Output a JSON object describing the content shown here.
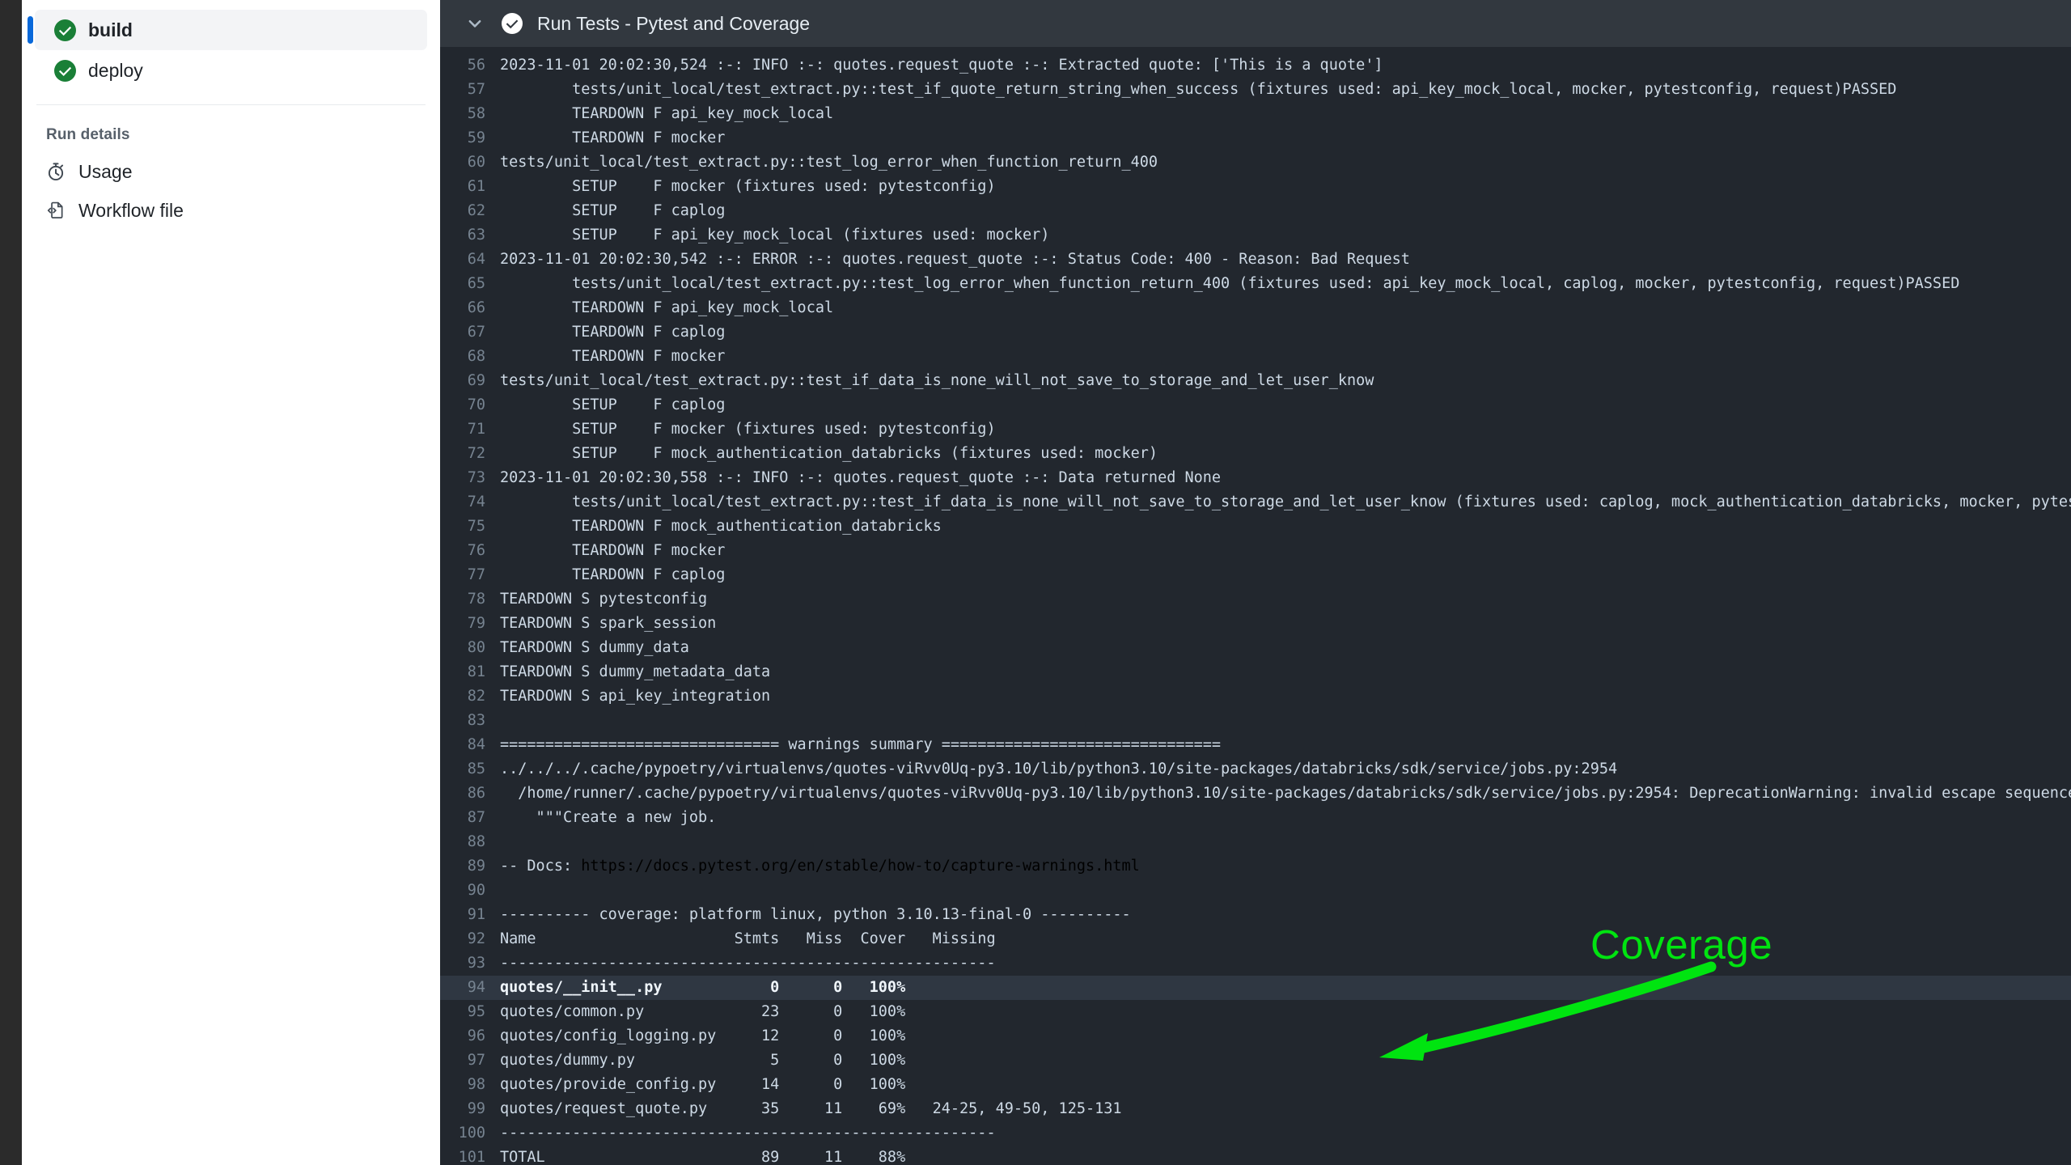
{
  "sidebar": {
    "jobs": [
      {
        "label": "build",
        "icon": "check-circle-success-icon",
        "active": true
      },
      {
        "label": "deploy",
        "icon": "check-circle-success-icon",
        "active": false
      }
    ],
    "section_title": "Run details",
    "details": [
      {
        "label": "Usage",
        "icon": "stopwatch-icon"
      },
      {
        "label": "Workflow file",
        "icon": "code-file-icon"
      }
    ]
  },
  "log": {
    "header": {
      "title": "Run Tests - Pytest and Coverage",
      "chevron_icon": "chevron-down-icon",
      "status_icon": "check-circle-icon"
    },
    "lines": [
      {
        "n": "56",
        "text": "2023-11-01 20:02:30,524 :-: INFO :-: quotes.request_quote :-: Extracted quote: ['This is a quote']"
      },
      {
        "n": "57",
        "text": "        tests/unit_local/test_extract.py::test_if_quote_return_string_when_success (fixtures used: api_key_mock_local, mocker, pytestconfig, request)PASSED"
      },
      {
        "n": "58",
        "text": "        TEARDOWN F api_key_mock_local"
      },
      {
        "n": "59",
        "text": "        TEARDOWN F mocker"
      },
      {
        "n": "60",
        "text": "tests/unit_local/test_extract.py::test_log_error_when_function_return_400"
      },
      {
        "n": "61",
        "text": "        SETUP    F mocker (fixtures used: pytestconfig)"
      },
      {
        "n": "62",
        "text": "        SETUP    F caplog"
      },
      {
        "n": "63",
        "text": "        SETUP    F api_key_mock_local (fixtures used: mocker)"
      },
      {
        "n": "64",
        "text": "2023-11-01 20:02:30,542 :-: ERROR :-: quotes.request_quote :-: Status Code: 400 - Reason: Bad Request"
      },
      {
        "n": "65",
        "text": "        tests/unit_local/test_extract.py::test_log_error_when_function_return_400 (fixtures used: api_key_mock_local, caplog, mocker, pytestconfig, request)PASSED"
      },
      {
        "n": "66",
        "text": "        TEARDOWN F api_key_mock_local"
      },
      {
        "n": "67",
        "text": "        TEARDOWN F caplog"
      },
      {
        "n": "68",
        "text": "        TEARDOWN F mocker"
      },
      {
        "n": "69",
        "text": "tests/unit_local/test_extract.py::test_if_data_is_none_will_not_save_to_storage_and_let_user_know"
      },
      {
        "n": "70",
        "text": "        SETUP    F caplog"
      },
      {
        "n": "71",
        "text": "        SETUP    F mocker (fixtures used: pytestconfig)"
      },
      {
        "n": "72",
        "text": "        SETUP    F mock_authentication_databricks (fixtures used: mocker)"
      },
      {
        "n": "73",
        "text": "2023-11-01 20:02:30,558 :-: INFO :-: quotes.request_quote :-: Data returned None"
      },
      {
        "n": "74",
        "text": "        tests/unit_local/test_extract.py::test_if_data_is_none_will_not_save_to_storage_and_let_user_know (fixtures used: caplog, mock_authentication_databricks, mocker, pytestconfig, request)PASSED"
      },
      {
        "n": "75",
        "text": "        TEARDOWN F mock_authentication_databricks"
      },
      {
        "n": "76",
        "text": "        TEARDOWN F mocker"
      },
      {
        "n": "77",
        "text": "        TEARDOWN F caplog"
      },
      {
        "n": "78",
        "text": "TEARDOWN S pytestconfig"
      },
      {
        "n": "79",
        "text": "TEARDOWN S spark_session"
      },
      {
        "n": "80",
        "text": "TEARDOWN S dummy_data"
      },
      {
        "n": "81",
        "text": "TEARDOWN S dummy_metadata_data"
      },
      {
        "n": "82",
        "text": "TEARDOWN S api_key_integration"
      },
      {
        "n": "83",
        "text": ""
      },
      {
        "n": "84",
        "text": "=============================== warnings summary ==============================="
      },
      {
        "n": "85",
        "text": "../../../.cache/pypoetry/virtualenvs/quotes-viRvv0Uq-py3.10/lib/python3.10/site-packages/databricks/sdk/service/jobs.py:2954"
      },
      {
        "n": "86",
        "text": "  /home/runner/.cache/pypoetry/virtualenvs/quotes-viRvv0Uq-py3.10/lib/python3.10/site-packages/databricks/sdk/service/jobs.py:2954: DeprecationWarning: invalid escape sequence '\\.'"
      },
      {
        "n": "87",
        "text": "    \"\"\"Create a new job."
      },
      {
        "n": "88",
        "text": ""
      },
      {
        "n": "89",
        "text": "-- Docs: ",
        "link": "https://docs.pytest.org/en/stable/how-to/capture-warnings.html"
      },
      {
        "n": "90",
        "text": ""
      },
      {
        "n": "91",
        "text": "---------- coverage: platform linux, python 3.10.13-final-0 ----------"
      },
      {
        "n": "92",
        "text": "Name                      Stmts   Miss  Cover   Missing"
      },
      {
        "n": "93",
        "text": "-------------------------------------------------------"
      },
      {
        "n": "94",
        "text": "quotes/__init__.py            0      0   100%",
        "highlight": true
      },
      {
        "n": "95",
        "text": "quotes/common.py             23      0   100%"
      },
      {
        "n": "96",
        "text": "quotes/config_logging.py     12      0   100%"
      },
      {
        "n": "97",
        "text": "quotes/dummy.py               5      0   100%"
      },
      {
        "n": "98",
        "text": "quotes/provide_config.py     14      0   100%"
      },
      {
        "n": "99",
        "text": "quotes/request_quote.py      35     11    69%   24-25, 49-50, 125-131"
      },
      {
        "n": "100",
        "text": "-------------------------------------------------------"
      },
      {
        "n": "101",
        "text": "TOTAL                        89     11    88%"
      }
    ]
  },
  "annotation": {
    "label": "Coverage",
    "color": "#00e410",
    "arrow_icon": "arrow-pointing-left-icon"
  },
  "coverage_table": {
    "columns": [
      "Name",
      "Stmts",
      "Miss",
      "Cover",
      "Missing"
    ],
    "rows": [
      {
        "Name": "quotes/__init__.py",
        "Stmts": "0",
        "Miss": "0",
        "Cover": "100%",
        "Missing": ""
      },
      {
        "Name": "quotes/common.py",
        "Stmts": "23",
        "Miss": "0",
        "Cover": "100%",
        "Missing": ""
      },
      {
        "Name": "quotes/config_logging.py",
        "Stmts": "12",
        "Miss": "0",
        "Cover": "100%",
        "Missing": ""
      },
      {
        "Name": "quotes/dummy.py",
        "Stmts": "5",
        "Miss": "0",
        "Cover": "100%",
        "Missing": ""
      },
      {
        "Name": "quotes/provide_config.py",
        "Stmts": "14",
        "Miss": "0",
        "Cover": "100%",
        "Missing": ""
      },
      {
        "Name": "quotes/request_quote.py",
        "Stmts": "35",
        "Miss": "11",
        "Cover": "69%",
        "Missing": "24-25, 49-50, 125-131"
      },
      {
        "Name": "TOTAL",
        "Stmts": "89",
        "Miss": "11",
        "Cover": "88%",
        "Missing": ""
      }
    ]
  },
  "colors": {
    "accent_blue": "#0969da",
    "success_green": "#1a7f37",
    "annotation_green": "#00e410",
    "log_bg": "#22272e",
    "log_header_bg": "#32383f",
    "log_row_highlight": "#2f3742"
  }
}
